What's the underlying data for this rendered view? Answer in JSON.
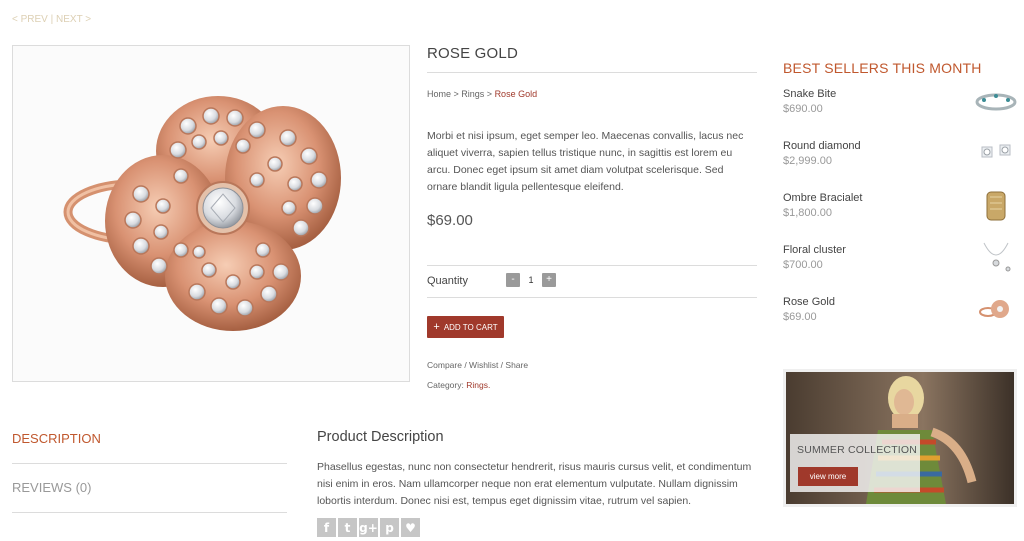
{
  "nav": {
    "prev": "< PREV",
    "separator": " | ",
    "next": "NEXT >"
  },
  "product": {
    "title": "ROSE GOLD",
    "breadcrumb": {
      "home": "Home",
      "sep": " > ",
      "category": "Rings",
      "current": "Rose Gold"
    },
    "description": "Morbi et nisi ipsum, eget semper leo. Maecenas convallis, lacus nec aliquet viverra, sapien tellus tristique nunc, in sagittis est lorem eu arcu. Donec eget ipsum sit amet diam volutpat scelerisque. Sed ornare blandit ligula pellentesque eleifend.",
    "price": "$69.00",
    "quantity_label": "Quantity",
    "quantity": "1",
    "minus": "-",
    "plus": "+",
    "add_to_cart": "ADD TO CART",
    "actions": "Compare / Wishlist / Share",
    "category_label": "Category:",
    "category_value": "Rings."
  },
  "best_sellers": {
    "title": "BEST SELLERS THIS MONTH",
    "items": [
      {
        "name": "Snake Bite",
        "price": "$690.00",
        "icon": "bracelet-thumb"
      },
      {
        "name": "Round diamond",
        "price": "$2,999.00",
        "icon": "earrings-thumb"
      },
      {
        "name": "Ombre Bracialet",
        "price": "$1,800.00",
        "icon": "cuff-thumb"
      },
      {
        "name": "Floral cluster",
        "price": "$700.00",
        "icon": "necklace-thumb"
      },
      {
        "name": "Rose Gold",
        "price": "$69.00",
        "icon": "ring-thumb"
      }
    ]
  },
  "banner": {
    "title": "SUMMER COLLECTION",
    "button": "view more"
  },
  "tabs": {
    "description": "DESCRIPTION",
    "reviews": "REVIEWS (0)"
  },
  "product_description": {
    "heading": "Product Description",
    "text": "Phasellus egestas, nunc non consectetur hendrerit, risus mauris cursus velit, et condimentum nisi enim in eros. Nam ullamcorper neque non erat elementum vulputate. Nullam dignissim lobortis interdum. Donec nisi est, tempus eget dignissim vitae, rutrum vel sapien."
  },
  "social": {
    "facebook": "f",
    "twitter": "t",
    "googleplus": "g+",
    "pinterest": "p",
    "like": "♥"
  },
  "colors": {
    "accent": "#a0392b",
    "heading_accent": "#c0582e",
    "nav": "#ddd0b4"
  }
}
